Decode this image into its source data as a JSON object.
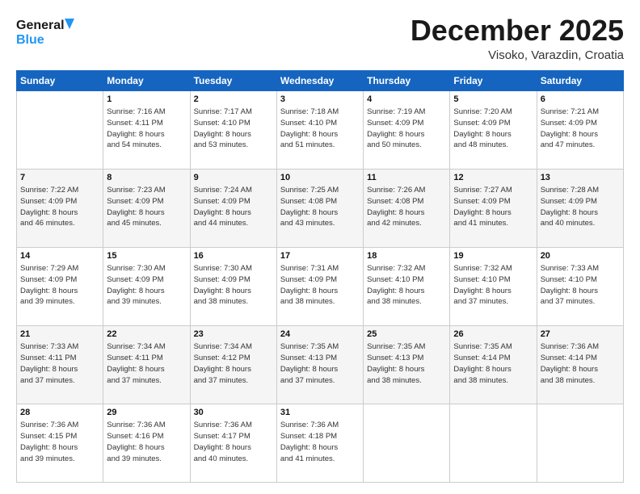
{
  "header": {
    "logo_line1": "General",
    "logo_line2": "Blue",
    "title": "December 2025",
    "subtitle": "Visoko, Varazdin, Croatia"
  },
  "days_of_week": [
    "Sunday",
    "Monday",
    "Tuesday",
    "Wednesday",
    "Thursday",
    "Friday",
    "Saturday"
  ],
  "weeks": [
    [
      {
        "day": "",
        "info": ""
      },
      {
        "day": "1",
        "info": "Sunrise: 7:16 AM\nSunset: 4:11 PM\nDaylight: 8 hours\nand 54 minutes."
      },
      {
        "day": "2",
        "info": "Sunrise: 7:17 AM\nSunset: 4:10 PM\nDaylight: 8 hours\nand 53 minutes."
      },
      {
        "day": "3",
        "info": "Sunrise: 7:18 AM\nSunset: 4:10 PM\nDaylight: 8 hours\nand 51 minutes."
      },
      {
        "day": "4",
        "info": "Sunrise: 7:19 AM\nSunset: 4:09 PM\nDaylight: 8 hours\nand 50 minutes."
      },
      {
        "day": "5",
        "info": "Sunrise: 7:20 AM\nSunset: 4:09 PM\nDaylight: 8 hours\nand 48 minutes."
      },
      {
        "day": "6",
        "info": "Sunrise: 7:21 AM\nSunset: 4:09 PM\nDaylight: 8 hours\nand 47 minutes."
      }
    ],
    [
      {
        "day": "7",
        "info": "Sunrise: 7:22 AM\nSunset: 4:09 PM\nDaylight: 8 hours\nand 46 minutes."
      },
      {
        "day": "8",
        "info": "Sunrise: 7:23 AM\nSunset: 4:09 PM\nDaylight: 8 hours\nand 45 minutes."
      },
      {
        "day": "9",
        "info": "Sunrise: 7:24 AM\nSunset: 4:09 PM\nDaylight: 8 hours\nand 44 minutes."
      },
      {
        "day": "10",
        "info": "Sunrise: 7:25 AM\nSunset: 4:08 PM\nDaylight: 8 hours\nand 43 minutes."
      },
      {
        "day": "11",
        "info": "Sunrise: 7:26 AM\nSunset: 4:08 PM\nDaylight: 8 hours\nand 42 minutes."
      },
      {
        "day": "12",
        "info": "Sunrise: 7:27 AM\nSunset: 4:09 PM\nDaylight: 8 hours\nand 41 minutes."
      },
      {
        "day": "13",
        "info": "Sunrise: 7:28 AM\nSunset: 4:09 PM\nDaylight: 8 hours\nand 40 minutes."
      }
    ],
    [
      {
        "day": "14",
        "info": "Sunrise: 7:29 AM\nSunset: 4:09 PM\nDaylight: 8 hours\nand 39 minutes."
      },
      {
        "day": "15",
        "info": "Sunrise: 7:30 AM\nSunset: 4:09 PM\nDaylight: 8 hours\nand 39 minutes."
      },
      {
        "day": "16",
        "info": "Sunrise: 7:30 AM\nSunset: 4:09 PM\nDaylight: 8 hours\nand 38 minutes."
      },
      {
        "day": "17",
        "info": "Sunrise: 7:31 AM\nSunset: 4:09 PM\nDaylight: 8 hours\nand 38 minutes."
      },
      {
        "day": "18",
        "info": "Sunrise: 7:32 AM\nSunset: 4:10 PM\nDaylight: 8 hours\nand 38 minutes."
      },
      {
        "day": "19",
        "info": "Sunrise: 7:32 AM\nSunset: 4:10 PM\nDaylight: 8 hours\nand 37 minutes."
      },
      {
        "day": "20",
        "info": "Sunrise: 7:33 AM\nSunset: 4:10 PM\nDaylight: 8 hours\nand 37 minutes."
      }
    ],
    [
      {
        "day": "21",
        "info": "Sunrise: 7:33 AM\nSunset: 4:11 PM\nDaylight: 8 hours\nand 37 minutes."
      },
      {
        "day": "22",
        "info": "Sunrise: 7:34 AM\nSunset: 4:11 PM\nDaylight: 8 hours\nand 37 minutes."
      },
      {
        "day": "23",
        "info": "Sunrise: 7:34 AM\nSunset: 4:12 PM\nDaylight: 8 hours\nand 37 minutes."
      },
      {
        "day": "24",
        "info": "Sunrise: 7:35 AM\nSunset: 4:13 PM\nDaylight: 8 hours\nand 37 minutes."
      },
      {
        "day": "25",
        "info": "Sunrise: 7:35 AM\nSunset: 4:13 PM\nDaylight: 8 hours\nand 38 minutes."
      },
      {
        "day": "26",
        "info": "Sunrise: 7:35 AM\nSunset: 4:14 PM\nDaylight: 8 hours\nand 38 minutes."
      },
      {
        "day": "27",
        "info": "Sunrise: 7:36 AM\nSunset: 4:14 PM\nDaylight: 8 hours\nand 38 minutes."
      }
    ],
    [
      {
        "day": "28",
        "info": "Sunrise: 7:36 AM\nSunset: 4:15 PM\nDaylight: 8 hours\nand 39 minutes."
      },
      {
        "day": "29",
        "info": "Sunrise: 7:36 AM\nSunset: 4:16 PM\nDaylight: 8 hours\nand 39 minutes."
      },
      {
        "day": "30",
        "info": "Sunrise: 7:36 AM\nSunset: 4:17 PM\nDaylight: 8 hours\nand 40 minutes."
      },
      {
        "day": "31",
        "info": "Sunrise: 7:36 AM\nSunset: 4:18 PM\nDaylight: 8 hours\nand 41 minutes."
      },
      {
        "day": "",
        "info": ""
      },
      {
        "day": "",
        "info": ""
      },
      {
        "day": "",
        "info": ""
      }
    ]
  ]
}
